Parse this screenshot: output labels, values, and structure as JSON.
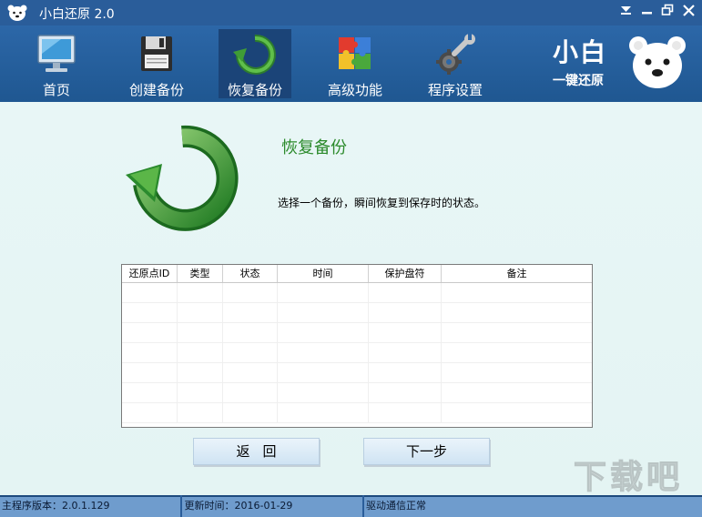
{
  "window": {
    "title": "小白还原 2.0",
    "controls": [
      "menu-icon",
      "minimize-icon",
      "restore-icon",
      "close-icon"
    ]
  },
  "toolbar": {
    "items": [
      {
        "label": "首页",
        "icon": "monitor-icon",
        "active": false
      },
      {
        "label": "创建备份",
        "icon": "floppy-disk-icon",
        "active": false
      },
      {
        "label": "恢复备份",
        "icon": "restore-arrow-icon",
        "active": true
      },
      {
        "label": "高级功能",
        "icon": "puzzle-icon",
        "active": false
      },
      {
        "label": "程序设置",
        "icon": "wrench-gear-icon",
        "active": false
      }
    ],
    "brand": {
      "line1": "小白",
      "line2": "一键还原",
      "icon": "bear-logo-icon"
    }
  },
  "main": {
    "title": "恢复备份",
    "description": "选择一个备份，瞬间恢复到保存时的状态。",
    "table": {
      "columns": [
        "还原点ID",
        "类型",
        "状态",
        "时间",
        "保护盘符",
        "备注"
      ],
      "rows": []
    },
    "buttons": {
      "back": "返回",
      "next": "下一步"
    },
    "watermark": "下载吧"
  },
  "statusbar": {
    "version": "主程序版本：2.0.1.129",
    "update_time": "更新时间：2016-01-29",
    "driver_status": "驱动通信正常"
  },
  "colors": {
    "title_bar": "#2a5d9a",
    "toolbar": "#2c67a8",
    "content_bg": "#e9f6f6",
    "accent_green": "#2b8a2b",
    "status_bar": "#6f9ccd"
  }
}
